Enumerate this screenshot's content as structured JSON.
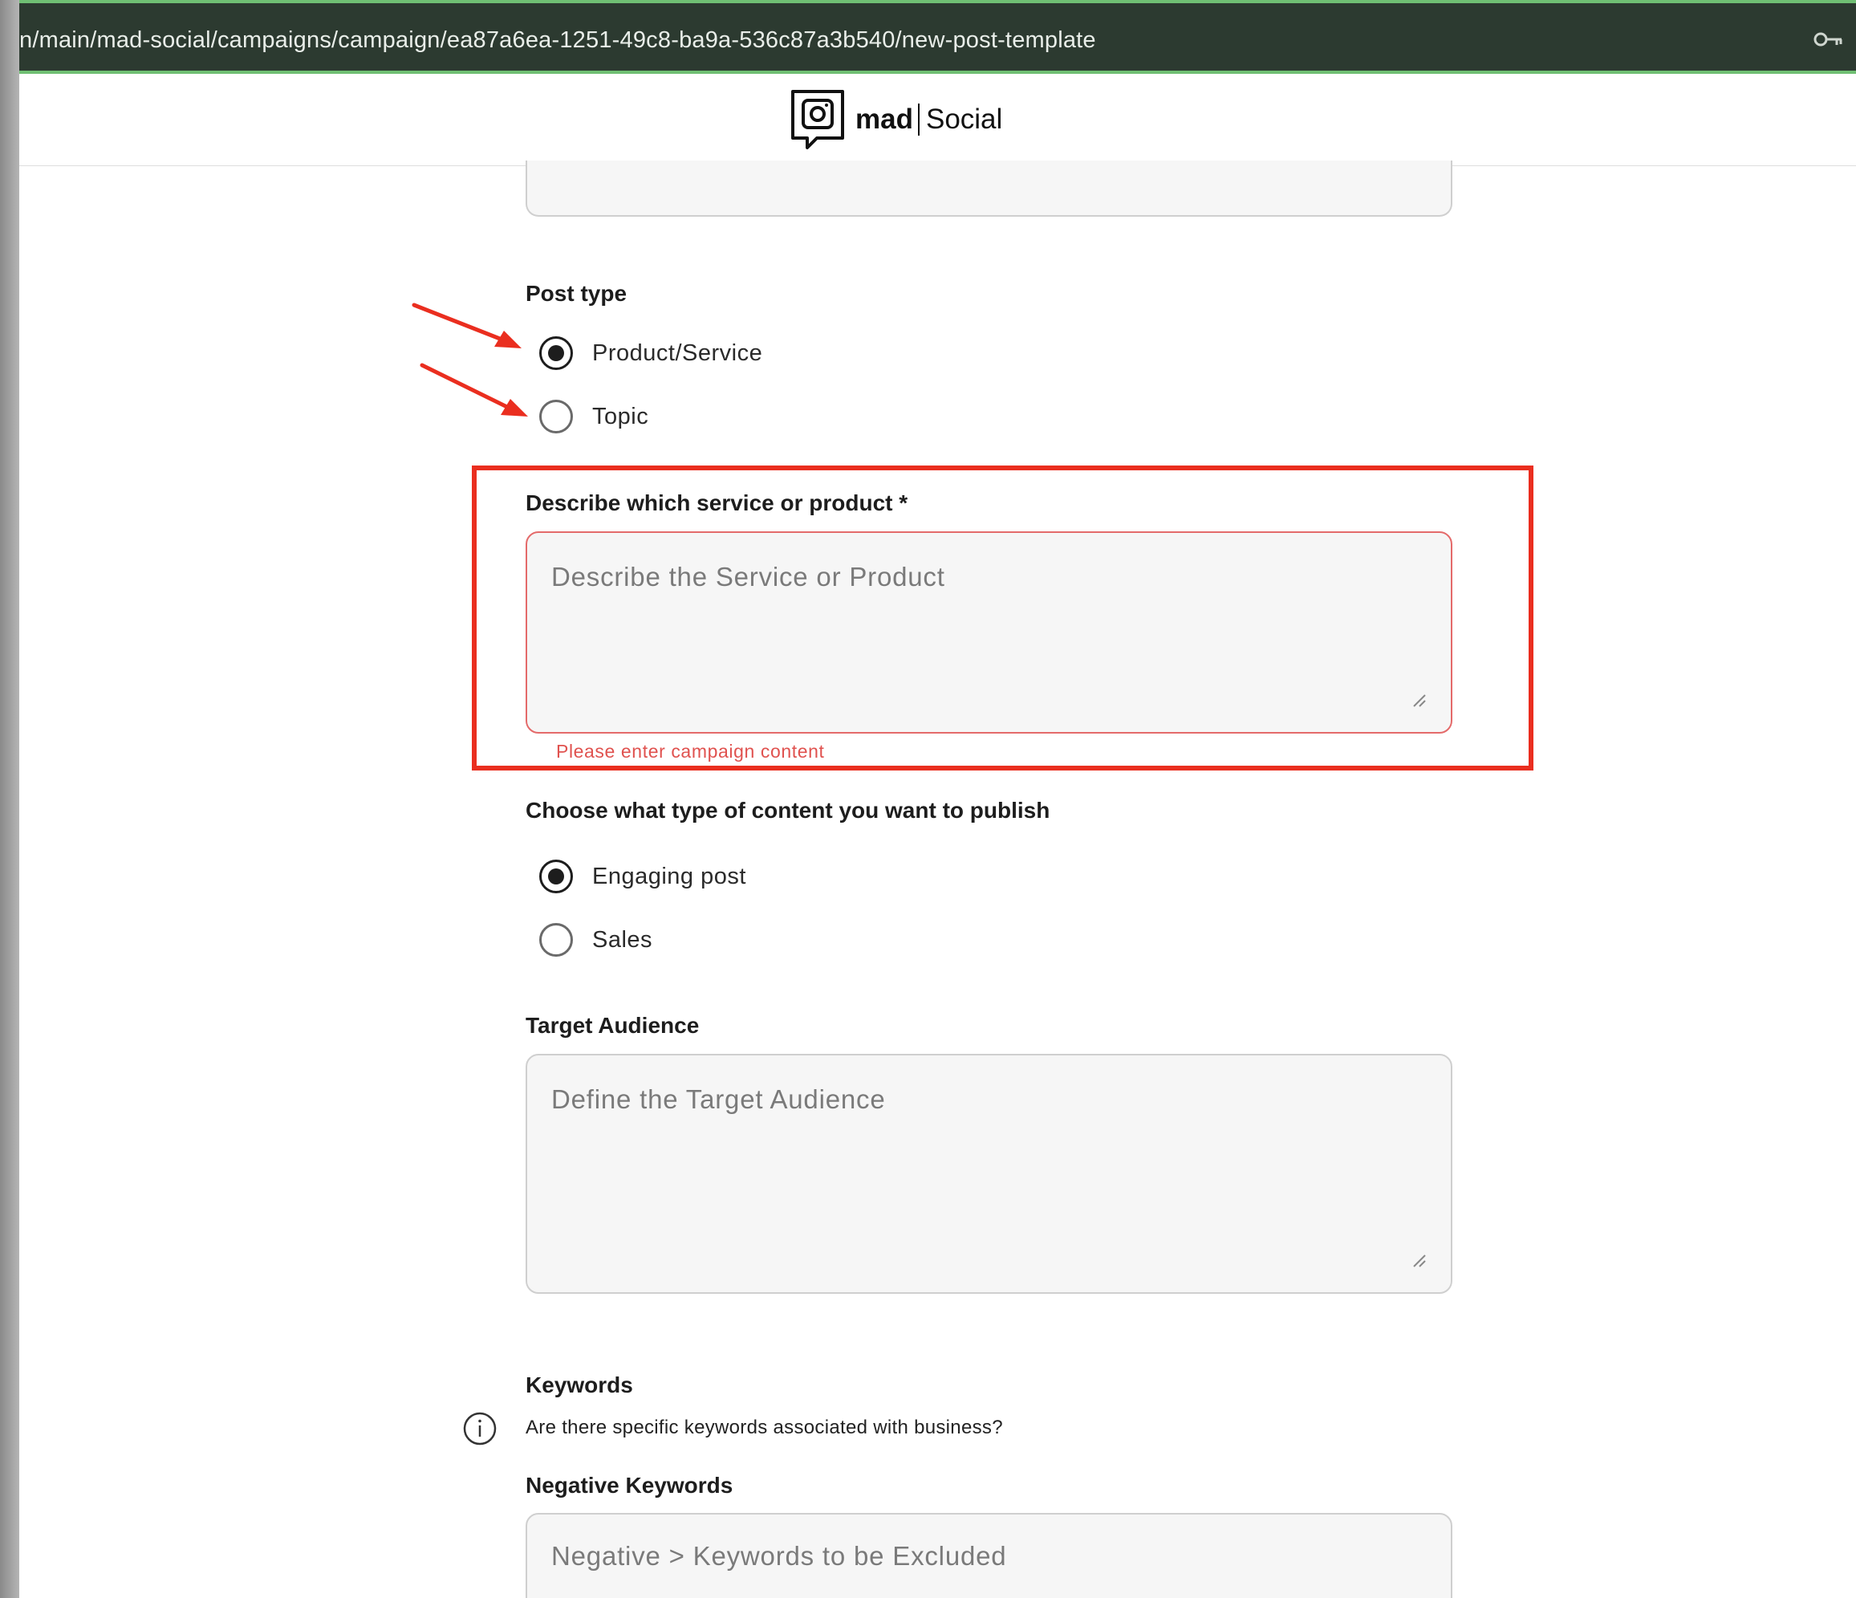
{
  "browser": {
    "url": "n/main/mad-social/campaigns/campaign/ea87a6ea-1251-49c8-ba9a-536c87a3b540/new-post-template",
    "key_icon": "key-icon"
  },
  "header": {
    "logo_bold": "mad",
    "logo_light": "Social",
    "logo_icon": "chat-camera-logo-icon"
  },
  "form": {
    "post_type": {
      "label": "Post type",
      "options": [
        {
          "label": "Product/Service",
          "checked": true
        },
        {
          "label": "Topic",
          "checked": false
        }
      ]
    },
    "describe": {
      "label": "Describe which service or product *",
      "placeholder": "Describe the Service or Product",
      "error": "Please enter campaign content"
    },
    "content_type": {
      "label": "Choose what type of content you want to publish",
      "options": [
        {
          "label": "Engaging post",
          "checked": true
        },
        {
          "label": "Sales",
          "checked": false
        }
      ]
    },
    "target_audience": {
      "label": "Target Audience",
      "placeholder": "Define the Target Audience"
    },
    "keywords": {
      "label": "Keywords",
      "hint": "Are there specific keywords associated with business?",
      "info_icon": "info-icon"
    },
    "negative_keywords": {
      "label": "Negative Keywords",
      "placeholder": "Negative > Keywords to be Excluded"
    }
  },
  "annotations": {
    "highlight_color": "#ea2e1f",
    "arrow_color": "#ea2e1f"
  }
}
